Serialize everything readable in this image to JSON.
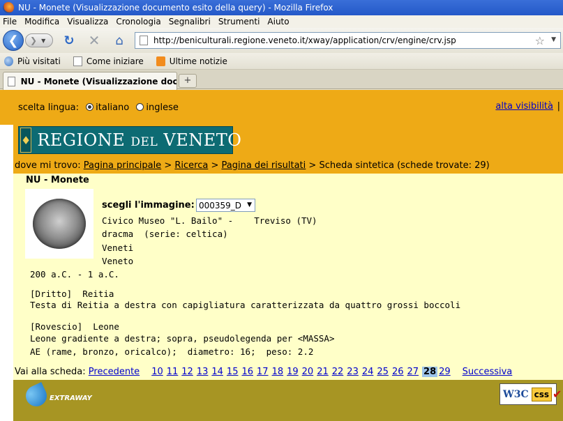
{
  "window": {
    "title": "NU - Monete (Visualizzazione documento esito della query) - Mozilla Firefox"
  },
  "menu": [
    "File",
    "Modifica",
    "Visualizza",
    "Cronologia",
    "Segnalibri",
    "Strumenti",
    "Aiuto"
  ],
  "nav": {
    "url": "http://beniculturali.regione.veneto.it/xway/application/crv/engine/crv.jsp"
  },
  "bookmarks": [
    "Più visitati",
    "Come iniziare",
    "Ultime notizie"
  ],
  "tab": {
    "label": "NU - Monete (Visualizzazione docum..."
  },
  "lang": {
    "label": "scelta lingua:",
    "option1": "italiano",
    "option2": "inglese",
    "selected": "italiano",
    "alta": "alta visibilità",
    "sep": "|"
  },
  "logo": {
    "text_main": "REGIONE",
    "text_small": "DEL",
    "text_end": "VENETO"
  },
  "breadcrumb": {
    "prefix": "dove mi trovo:",
    "home": "Pagina principale",
    "search": "Ricerca",
    "results": "Pagina dei risultati",
    "current": "Scheda sintetica (schede trovate: 29)"
  },
  "record": {
    "heading": "NU - Monete",
    "image_label": "scegli l'immagine:",
    "image_value": "000359_D",
    "museum": "Civico Museo \"L. Bailo\" -    Treviso (TV)",
    "type": "dracma  (serie: celtica)",
    "culture": "Veneti",
    "region": "Veneto",
    "date": "200 a.C. - 1 a.C.",
    "obverse_title": "[Dritto]  Reitia",
    "obverse_desc": "Testa di Reitia a destra con capigliatura caratterizzata da quattro grossi boccoli",
    "reverse_title": "[Rovescio]  Leone",
    "reverse_desc": "Leone gradiente a destra; sopra, pseudolegenda per <MASSA>",
    "material": "AE (rame, bronzo, oricalco);  diametro: 16;  peso: 2.2"
  },
  "pager": {
    "label": "Vai alla scheda:",
    "prev": "Precedente",
    "pages": [
      "10",
      "11",
      "12",
      "13",
      "14",
      "15",
      "16",
      "17",
      "18",
      "19",
      "20",
      "21",
      "22",
      "23",
      "24",
      "25",
      "26",
      "27"
    ],
    "current": "28",
    "after": [
      "29"
    ],
    "next": "Successiva"
  },
  "footer": {
    "ext_text": "EXTRAWAY",
    "w3c": "W3C",
    "css": "css",
    "check": "✔"
  }
}
